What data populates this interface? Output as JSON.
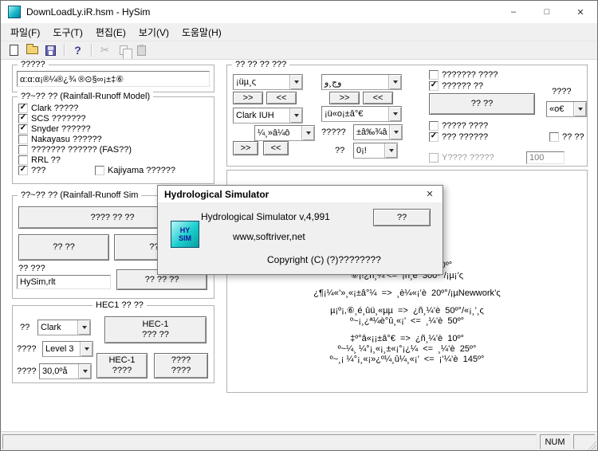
{
  "window": {
    "title": "DownLoadLy.iR.hsm - HySim",
    "minimize_glyph": "–",
    "maximize_glyph": "□",
    "close_glyph": "✕"
  },
  "menu": {
    "items": [
      {
        "label": "파일(F)"
      },
      {
        "label": "도구(T)"
      },
      {
        "label": "편집(E)"
      },
      {
        "label": "보기(V)"
      },
      {
        "label": "도움말(H)"
      }
    ]
  },
  "toolbar": {
    "help_glyph": "?",
    "cut_glyph": "✂"
  },
  "left": {
    "name_group": {
      "label": "?????",
      "value": "α:α:α¡®¼®¿¾ ®⊙§∞¡±‡⑥"
    },
    "model_group": {
      "label": "??~?? ?? (Rainfall-Runoff Model)",
      "items": [
        {
          "label": "Clark ?????",
          "mark": "✓"
        },
        {
          "label": "SCS ???????",
          "mark": "✓"
        },
        {
          "label": "Snyder ??????",
          "mark": "✓"
        },
        {
          "label": "Nakayasu ??????",
          "mark": ""
        },
        {
          "label": "??????? ?????? (FAS??)",
          "mark": ""
        },
        {
          "label": "RRL ??",
          "mark": ""
        },
        {
          "label": "???",
          "mark": "✓"
        },
        {
          "label": "Kajiyama ??????",
          "mark": ""
        }
      ]
    },
    "sim_group": {
      "label": "??~?? ?? (Rainfall-Runoff Sim",
      "run_button": "???? ?? ??",
      "button_left": "?? ??",
      "button_right": "?? ??",
      "result_label": "?? ???",
      "result_file": "HySim,rlt",
      "view_button": "?? ?? ??"
    },
    "hec1_group": {
      "label": "HEC1 ?? ??",
      "method_label": "??",
      "method_value": "Clark",
      "level_label": "????",
      "level_value": "Level 3",
      "interval_label": "????",
      "interval_value": "30,0ºå",
      "main_button": [
        "HEC-1",
        "??? ??"
      ],
      "run_button": [
        "HEC-1",
        "????"
      ],
      "view_button": [
        "????",
        "????"
      ]
    }
  },
  "right": {
    "transfer_group": {
      "label": "?? ?? ?? ???",
      "combo_a": "¡üµ¸ς",
      "combo_b": "وج¸و",
      "combo_c": "Clark IUH",
      "combo_d": "¡ü«ο¡±â°€",
      "combo_e": "¼¸»â¼ô",
      "combo_f_label": "?????",
      "combo_f": "±â‰¾â",
      "combo_g_label": "??",
      "combo_g": "0¡!",
      "forward_label": ">>",
      "back_label": "<<",
      "checks": [
        {
          "label": "??????? ????",
          "mark": ""
        },
        {
          "label": "?????? ??",
          "mark": "✓"
        },
        {
          "label": "????? ????",
          "mark": ""
        },
        {
          "label": "??? ??????",
          "mark": "✓"
        },
        {
          "label": "?? ??",
          "mark": ""
        },
        {
          "label": "Y???? ?????",
          "mark": ""
        }
      ],
      "run_button": "?? ??",
      "combo_h_label": "????",
      "combo_h": "«ο€",
      "y_value": "100"
    },
    "info_group": {
      "lines": [
        "¡ü⑥‡¿µ  =>  ¿ñ¸è  60º°",
        "⑥¡!¿ñ¸¼ <=  ¡ñ¸è  300º°/¡µ¡’ς",
        "¿¶¡¼«’»¸«¡±â°¼  =>  ¸è¼«¡’è  20º°/¡µNewwork’ς",
        "µ¡º¡,⑥¸é¸ûü¸«µµ  =>  ¿ñ¸¼’è  50º°/«¡¸’¸ς",
        "º~¡¸¿ª¼è°û¸«¡’  <=  ¸¼’è  50º°",
        "‡º°â«¡¡±â°€  =>  ¿ñ¸¼’è  10º°",
        "º~¼¸ ¼°¡¸«¡¸±«¡°¡¿¼  <=  ¸¼’è  25º°",
        "º~¸¡ ¼°¡¸«¡»¿º¼¸û¼¸«¡’  <=  ¡’¼’è  145º°"
      ]
    }
  },
  "dialog": {
    "title": "Hydrological Simulator",
    "close_glyph": "✕",
    "version_line": "Hydrological Simulator v,4,991",
    "ok_button": "??",
    "website": "www,softriver,net",
    "copyright": "Copyright (C) (?)????????",
    "icon_text_top": "HY",
    "icon_text_bottom": "SIM"
  },
  "statusbar": {
    "num_label": "NUM"
  }
}
